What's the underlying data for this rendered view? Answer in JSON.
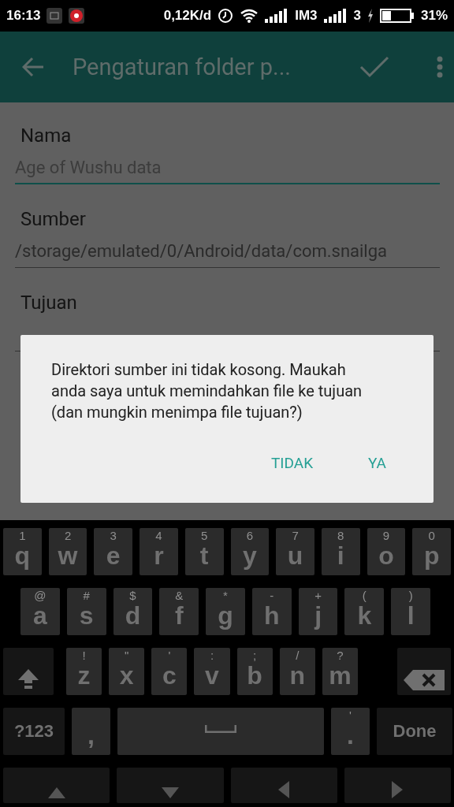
{
  "status_bar": {
    "time": "16:13",
    "data_rate": "0,12K/d",
    "carrier_1": "IM3",
    "carrier_2": "3",
    "battery": "31%"
  },
  "app_bar": {
    "title": "Pengaturan folder p..."
  },
  "form": {
    "fields": [
      {
        "label": "Nama",
        "placeholder": "Age of Wushu data",
        "focused": true
      },
      {
        "label": "Sumber",
        "value": "/storage/emulated/0/Android/data/com.snailga",
        "focused": false
      },
      {
        "label": "Tujuan",
        "focused": false
      }
    ]
  },
  "dialog": {
    "message": "Direktori sumber ini tidak kosong. Maukah anda saya untuk memindahkan file ke tujuan (dan mungkin menimpa file tujuan?)",
    "buttons": [
      "TIDAK",
      "YA"
    ]
  },
  "keyboard": {
    "rows": [
      {
        "keys": [
          {
            "kind": "letter",
            "main": "q",
            "hint": "1"
          },
          {
            "kind": "letter",
            "main": "w",
            "hint": "2"
          },
          {
            "kind": "letter",
            "main": "e",
            "hint": "3"
          },
          {
            "kind": "letter",
            "main": "r",
            "hint": "4"
          },
          {
            "kind": "letter",
            "main": "t",
            "hint": "5"
          },
          {
            "kind": "letter",
            "main": "y",
            "hint": "6"
          },
          {
            "kind": "letter",
            "main": "u",
            "hint": "7"
          },
          {
            "kind": "letter",
            "main": "i",
            "hint": "8"
          },
          {
            "kind": "letter",
            "main": "o",
            "hint": "9"
          },
          {
            "kind": "letter",
            "main": "p",
            "hint": "0"
          }
        ]
      },
      {
        "keys": [
          {
            "kind": "letter",
            "main": "a",
            "hint": "@"
          },
          {
            "kind": "letter",
            "main": "s",
            "hint": "#"
          },
          {
            "kind": "letter",
            "main": "d",
            "hint": "$"
          },
          {
            "kind": "letter",
            "main": "f",
            "hint": "&"
          },
          {
            "kind": "letter",
            "main": "g",
            "hint": "*"
          },
          {
            "kind": "letter",
            "main": "h",
            "hint": "-"
          },
          {
            "kind": "letter",
            "main": "j",
            "hint": "+"
          },
          {
            "kind": "letter",
            "main": "k",
            "hint": "("
          },
          {
            "kind": "letter",
            "main": "l",
            "hint": ")"
          }
        ]
      },
      {
        "keys": [
          {
            "kind": "shift"
          },
          {
            "kind": "letter",
            "main": "z",
            "hint": "!"
          },
          {
            "kind": "letter",
            "main": "x",
            "hint": "\""
          },
          {
            "kind": "letter",
            "main": "c",
            "hint": "'"
          },
          {
            "kind": "letter",
            "main": "v",
            "hint": ":"
          },
          {
            "kind": "letter",
            "main": "b",
            "hint": ";"
          },
          {
            "kind": "letter",
            "main": "n",
            "hint": "/"
          },
          {
            "kind": "letter",
            "main": "m",
            "hint": "?"
          },
          {
            "kind": "backspace"
          }
        ]
      },
      {
        "keys": [
          {
            "kind": "mode",
            "main": "?123"
          },
          {
            "kind": "letter",
            "main": ","
          },
          {
            "kind": "space"
          },
          {
            "kind": "letter",
            "main": ".",
            "hint": "'"
          },
          {
            "kind": "mode",
            "main": "Done"
          }
        ]
      },
      {
        "keys": [
          {
            "kind": "up"
          },
          {
            "kind": "down"
          },
          {
            "kind": "left"
          },
          {
            "kind": "right"
          }
        ]
      }
    ]
  }
}
